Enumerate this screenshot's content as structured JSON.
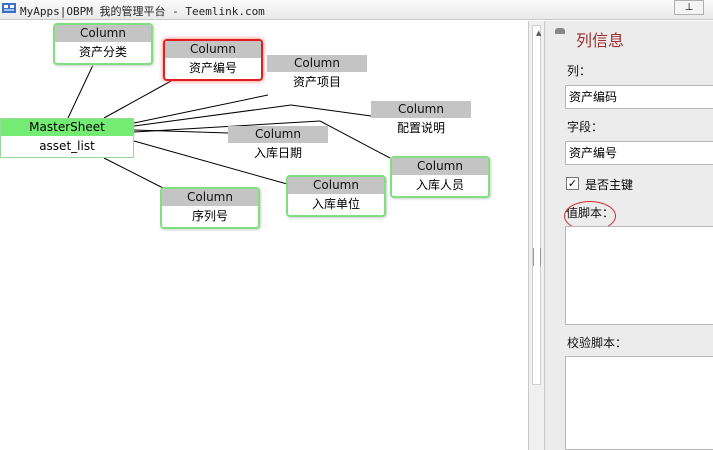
{
  "window": {
    "title": "MyApps|OBPM 我的管理平台 - Teemlink.com",
    "pin_icon": "pin-icon"
  },
  "master": {
    "type": "MasterSheet",
    "name": "asset_list",
    "color": "#74ec74"
  },
  "columns": [
    {
      "type": "Column",
      "label": "资产分类"
    },
    {
      "type": "Column",
      "label": "资产编号"
    },
    {
      "type": "Column",
      "label": "资产项目"
    },
    {
      "type": "Column",
      "label": "配置说明"
    },
    {
      "type": "Column",
      "label": "入库日期"
    },
    {
      "type": "Column",
      "label": "入库人员"
    },
    {
      "type": "Column",
      "label": "入库单位"
    },
    {
      "type": "Column",
      "label": "序列号"
    }
  ],
  "panel": {
    "title": "列信息",
    "column_label": "列：",
    "column_value": "资产编码",
    "field_label": "字段：",
    "field_value": "资产编号",
    "primary_key_label": "是否主键",
    "primary_key_checked": true,
    "value_script_label": "值脚本：",
    "validate_script_label": "校验脚本："
  },
  "colors": {
    "selected_border": "#e02020",
    "node_border": "#7fe07f",
    "panel_title": "#a03030"
  }
}
